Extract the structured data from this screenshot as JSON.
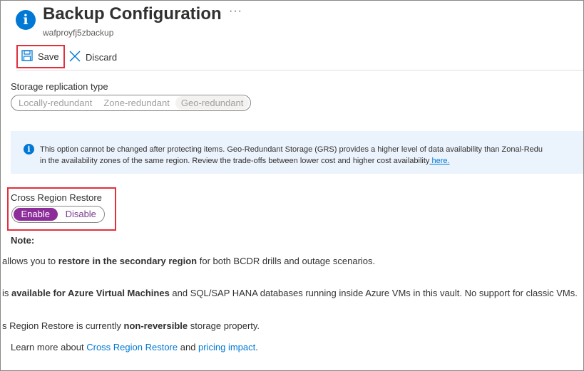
{
  "header": {
    "title": "Backup Configuration",
    "subtitle": "wafproyfj5zbackup",
    "more_label": "···",
    "title_icon": "info-icon"
  },
  "toolbar": {
    "save_label": "Save",
    "discard_label": "Discard"
  },
  "storage_replication": {
    "label": "Storage replication type",
    "options": [
      "Locally-redundant",
      "Zone-redundant",
      "Geo-redundant"
    ],
    "selected": "Geo-redundant"
  },
  "info_banner": {
    "line1": "This option cannot be changed after protecting items. Geo-Redundant Storage (GRS) provides a higher level of data availability than Zonal-Redu",
    "line2": "in the availability zones of the same region. Review the trade-offs between lower cost and higher cost availability",
    "link": " here."
  },
  "cross_region_restore": {
    "label": "Cross Region Restore",
    "enable_label": "Enable",
    "disable_label": "Disable",
    "selected": "Enable"
  },
  "notes": {
    "title": "Note:",
    "line1_pre": "allows you to ",
    "line1_bold": "restore in the secondary region",
    "line1_post": " for both BCDR drills and outage scenarios.",
    "line2_pre": "is ",
    "line2_bold": "available for Azure Virtual Machines",
    "line2_post": " and SQL/SAP HANA databases running inside Azure VMs in this vault. No support for classic VMs.",
    "line3_pre": "s Region Restore is currently ",
    "line3_bold": "non-reversible",
    "line3_post": " storage property.",
    "learn_pre": "Learn more about ",
    "learn_link1": "Cross Region Restore",
    "learn_mid": " and ",
    "learn_link2": "pricing impact",
    "learn_post": "."
  },
  "colors": {
    "accent": "#0078d4",
    "toggle_selected": "#8c2d9a",
    "highlight_border": "#e0303c",
    "info_bg": "#ebf3fc"
  }
}
